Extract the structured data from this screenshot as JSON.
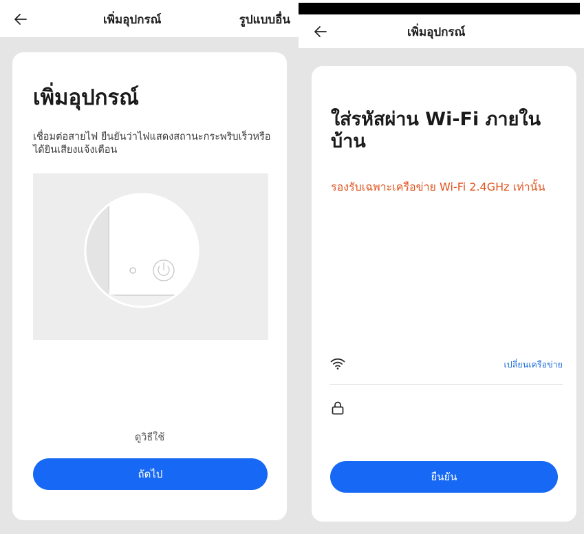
{
  "left_screen": {
    "header": {
      "title": "เพิ่มอุปกรณ์",
      "alt_mode_label": "รูปแบบอื่น"
    },
    "card": {
      "title": "เพิ่มอุปกรณ์",
      "instruction": "เชื่อมต่อสายไฟ ยืนยันว่าไฟแสดงสถานะกระพริบเร็วหรือได้ยินเสียงแจ้งเตือน",
      "howto_label": "ดูวิธีใช้",
      "next_label": "ถัดไป"
    }
  },
  "right_screen": {
    "header": {
      "title": "เพิ่มอุปกรณ์"
    },
    "card": {
      "title": "ใส่รหัสผ่าน Wi-Fi ภายในบ้าน",
      "warning": "รองรับเฉพาะเครือข่าย Wi-Fi 2.4GHz เท่านั้น",
      "change_network_label": "เปลี่ยนเครือข่าย",
      "password_value": "",
      "confirm_label": "ยืนยัน"
    }
  },
  "colors": {
    "primary": "#1668f5",
    "warning": "#e0531d",
    "link": "#1e6fd8",
    "background": "#e5e5e5"
  },
  "icons": [
    "back-arrow-icon",
    "device-power-illustration",
    "wifi-icon",
    "lock-icon"
  ]
}
